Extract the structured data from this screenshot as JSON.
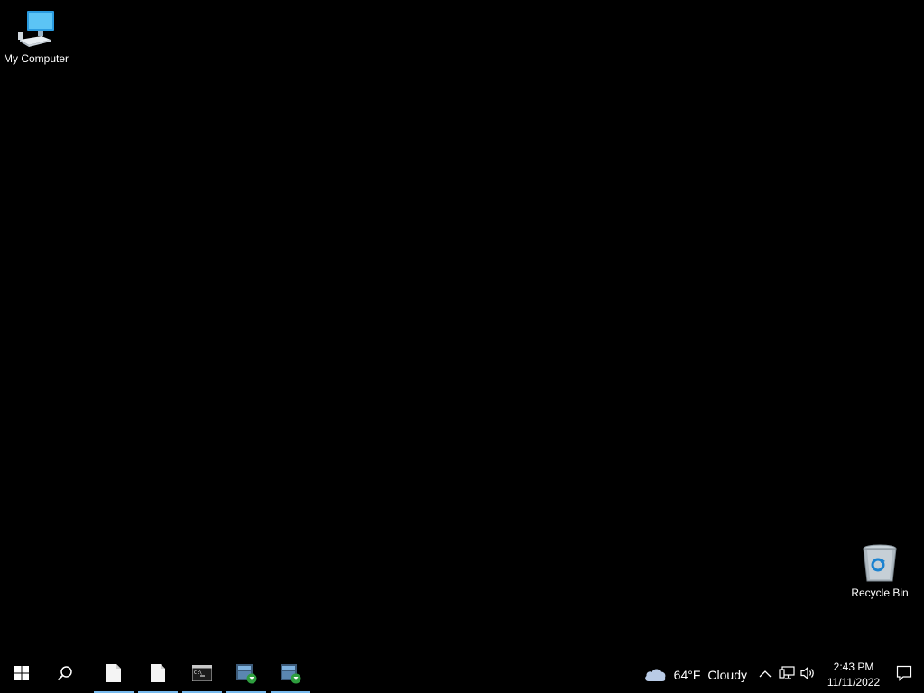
{
  "desktop": {
    "background": "#000000",
    "icons": [
      {
        "label": "My Computer",
        "icon": "computer-icon"
      },
      {
        "label": "Recycle Bin",
        "icon": "recycle-bin-icon"
      }
    ]
  },
  "taskbar": {
    "background": "#000000",
    "accent": "#76b9ed",
    "start_icon": "windows-logo-icon",
    "search_icon": "search-icon",
    "apps": [
      {
        "icon": "document-icon"
      },
      {
        "icon": "document-icon"
      },
      {
        "icon": "command-prompt-icon"
      },
      {
        "icon": "installer-icon"
      },
      {
        "icon": "installer-icon"
      }
    ],
    "weather": {
      "icon": "cloud-icon",
      "temperature": "64°F",
      "condition": "Cloudy"
    },
    "tray_icons": [
      "chevron-up-icon",
      "network-icon",
      "volume-icon"
    ],
    "clock": {
      "time": "2:43 PM",
      "date": "11/11/2022"
    },
    "notification_icon": "notification-icon"
  }
}
